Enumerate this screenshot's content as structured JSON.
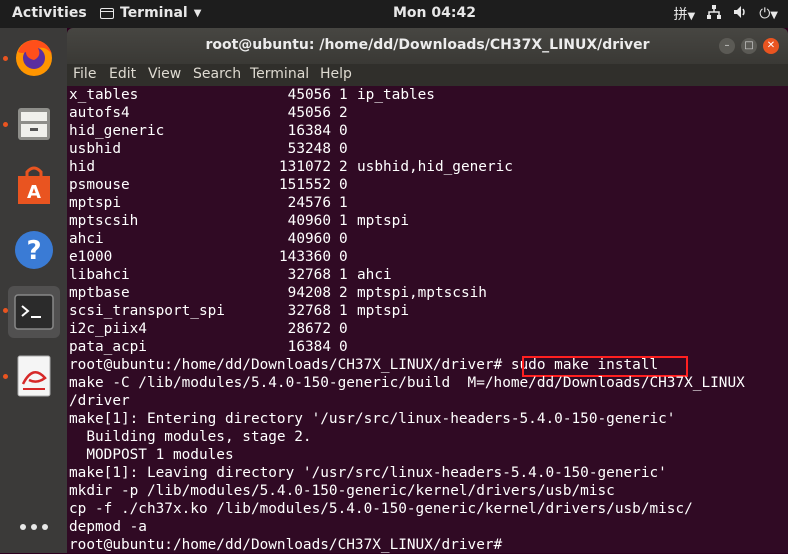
{
  "topbar": {
    "activities": "Activities",
    "app_name": "Terminal",
    "clock": "Mon 04:42"
  },
  "window": {
    "title": "root@ubuntu: /home/dd/Downloads/CH37X_LINUX/driver"
  },
  "menu": {
    "file": "File",
    "edit": "Edit",
    "view": "View",
    "search": "Search",
    "terminal": "Terminal",
    "help": "Help"
  },
  "modules": [
    {
      "name": "x_tables",
      "size": "45056",
      "used": "1",
      "by": "ip_tables"
    },
    {
      "name": "autofs4",
      "size": "45056",
      "used": "2",
      "by": ""
    },
    {
      "name": "hid_generic",
      "size": "16384",
      "used": "0",
      "by": ""
    },
    {
      "name": "usbhid",
      "size": "53248",
      "used": "0",
      "by": ""
    },
    {
      "name": "hid",
      "size": "131072",
      "used": "2",
      "by": "usbhid,hid_generic"
    },
    {
      "name": "psmouse",
      "size": "151552",
      "used": "0",
      "by": ""
    },
    {
      "name": "mptspi",
      "size": "24576",
      "used": "1",
      "by": ""
    },
    {
      "name": "mptscsih",
      "size": "40960",
      "used": "1",
      "by": "mptspi"
    },
    {
      "name": "ahci",
      "size": "40960",
      "used": "0",
      "by": ""
    },
    {
      "name": "e1000",
      "size": "143360",
      "used": "0",
      "by": ""
    },
    {
      "name": "libahci",
      "size": "32768",
      "used": "1",
      "by": "ahci"
    },
    {
      "name": "mptbase",
      "size": "94208",
      "used": "2",
      "by": "mptspi,mptscsih"
    },
    {
      "name": "scsi_transport_spi",
      "size": "32768",
      "used": "1",
      "by": "mptspi"
    },
    {
      "name": "i2c_piix4",
      "size": "28672",
      "used": "0",
      "by": ""
    },
    {
      "name": "pata_acpi",
      "size": "16384",
      "used": "0",
      "by": ""
    }
  ],
  "prompt": "root@ubuntu:/home/dd/Downloads/CH37X_LINUX/driver# ",
  "command": "sudo make install",
  "output": [
    "make -C /lib/modules/5.4.0-150-generic/build  M=/home/dd/Downloads/CH37X_LINUX",
    "/driver",
    "make[1]: Entering directory '/usr/src/linux-headers-5.4.0-150-generic'",
    "  Building modules, stage 2.",
    "  MODPOST 1 modules",
    "make[1]: Leaving directory '/usr/src/linux-headers-5.4.0-150-generic'",
    "mkdir -p /lib/modules/5.4.0-150-generic/kernel/drivers/usb/misc",
    "cp -f ./ch37x.ko /lib/modules/5.4.0-150-generic/kernel/drivers/usb/misc/",
    "depmod -a"
  ],
  "final_prompt": "root@ubuntu:/home/dd/Downloads/CH37X_LINUX/driver# ",
  "colors": {
    "terminal_bg": "#300a24",
    "accent": "#e95420",
    "highlight_box": "#ff2020"
  },
  "dock_icons": [
    "firefox-icon",
    "files-icon",
    "software-store-icon",
    "help-icon",
    "terminal-icon",
    "document-viewer-icon",
    "show-apps-icon"
  ]
}
